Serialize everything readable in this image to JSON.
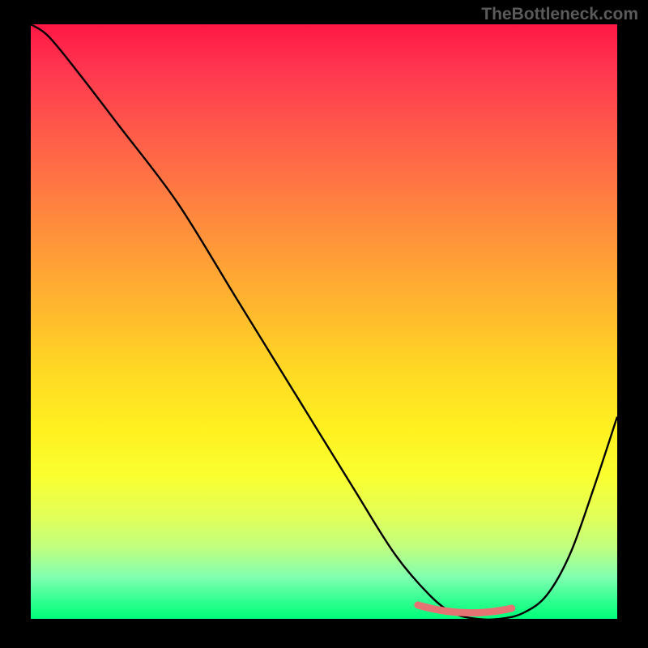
{
  "watermark": "TheBottleneck.com",
  "chart_data": {
    "type": "line",
    "title": "",
    "xlabel": "",
    "ylabel": "",
    "xlim": [
      0,
      100
    ],
    "ylim": [
      0,
      100
    ],
    "grid": false,
    "series": [
      {
        "name": "bottleneck-curve",
        "x": [
          0,
          3,
          8,
          15,
          25,
          35,
          45,
          55,
          62,
          68,
          72,
          76,
          80,
          84,
          88,
          92,
          96,
          100
        ],
        "y": [
          100,
          98,
          92,
          83,
          70,
          54,
          38,
          22,
          11,
          4,
          1,
          0,
          0,
          1,
          4,
          11,
          22,
          34
        ]
      }
    ],
    "annotations": [
      {
        "name": "optimal-range-highlight",
        "x_range": [
          66,
          82
        ],
        "y": 0
      }
    ],
    "background_gradient": {
      "direction": "vertical",
      "stops": [
        {
          "pos": 0.0,
          "color": "#ff1744"
        },
        {
          "pos": 0.5,
          "color": "#ffd824"
        },
        {
          "pos": 0.8,
          "color": "#faff30"
        },
        {
          "pos": 1.0,
          "color": "#00ff7a"
        }
      ]
    }
  }
}
